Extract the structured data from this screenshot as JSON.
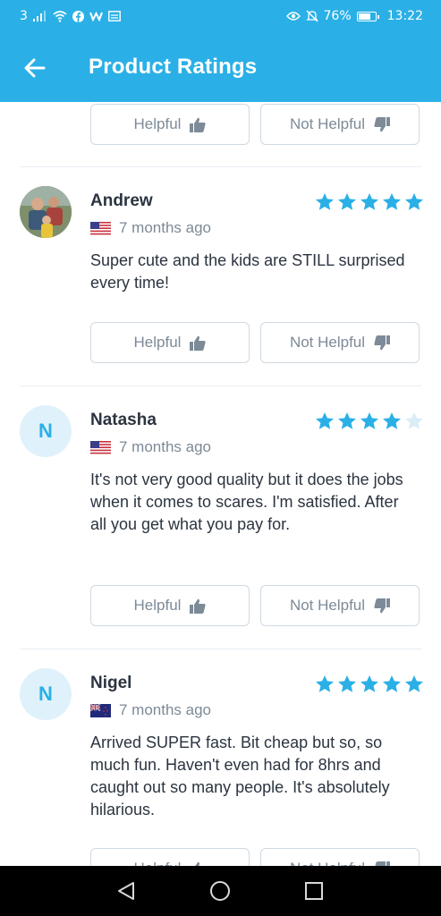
{
  "status_bar": {
    "carrier": "3",
    "battery_percent": "76%",
    "time": "13:22"
  },
  "app_bar": {
    "title": "Product Ratings",
    "back_icon": "arrow-left-icon"
  },
  "buttons": {
    "helpful": "Helpful",
    "not_helpful": "Not Helpful"
  },
  "reviews": [
    {
      "name": "Andrew",
      "avatar": "photo",
      "rating": 5,
      "flag": "us-flag-icon",
      "date": "7 months ago",
      "text": "Super cute and the kids are STILL surprised every time!"
    },
    {
      "name": "Natasha",
      "avatar": "N",
      "rating": 4,
      "flag": "us-flag-icon",
      "date": "7 months ago",
      "text": "It's not very good quality but it does the jobs when it comes to scares. I'm satisfied. After all you get what you pay for."
    },
    {
      "name": "Nigel",
      "avatar": "N",
      "rating": 5,
      "flag": "nz-flag-icon",
      "date": "7 months ago",
      "text": "Arrived SUPER fast. Bit cheap but so, so much fun. Haven't even had for 8hrs and caught out so many people. It's absolutely hilarious."
    }
  ],
  "colors": {
    "accent": "#2ab0e6",
    "star_filled": "#2ab0e6",
    "star_empty": "#d9edf7",
    "avatar_bg": "#dff1fb",
    "border": "#cfd9e2"
  }
}
